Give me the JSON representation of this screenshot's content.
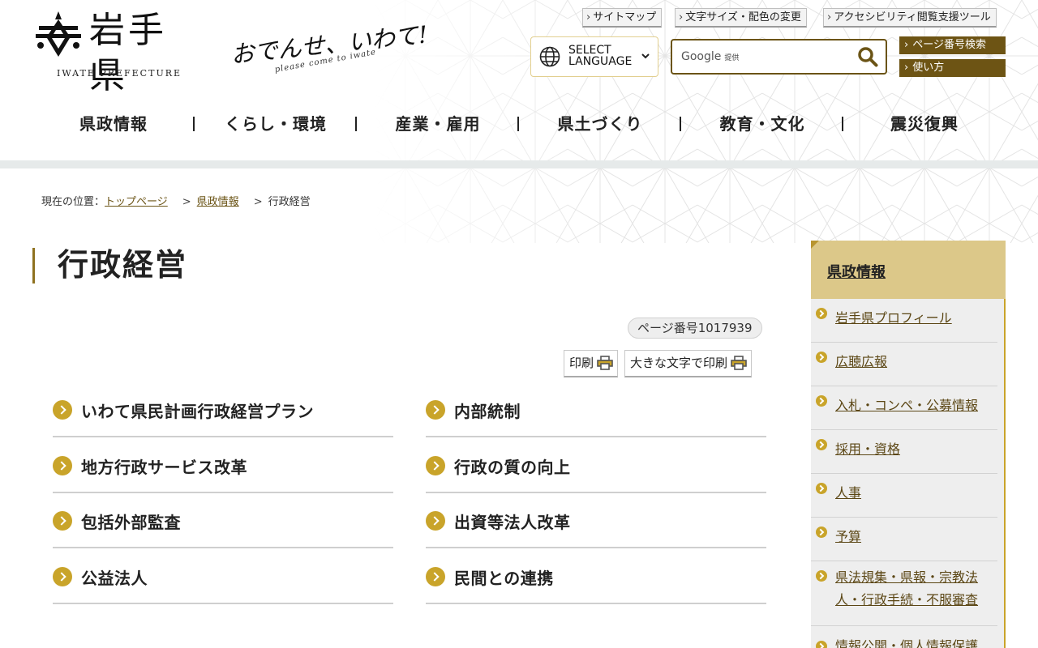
{
  "header": {
    "logo_name": "岩手県",
    "logo_sub": "IWATE PREFECTURE",
    "catch_main": "おでんせ、いわて!",
    "catch_sub": "please come to iwate",
    "util_links": [
      "サイトマップ",
      "文字サイズ・配色の変更",
      "アクセシビリティ閲覧支援ツール"
    ],
    "language": {
      "line1": "SELECT",
      "line2": "LANGUAGE"
    },
    "search": {
      "brand": "Google",
      "brand_sub": "提供",
      "placeholder": ""
    },
    "side_buttons": [
      "ページ番号検索",
      "使い方"
    ]
  },
  "global_nav": [
    "県政情報",
    "くらし・環境",
    "産業・雇用",
    "県土づくり",
    "教育・文化",
    "震災復興"
  ],
  "breadcrumb": {
    "prefix": "現在の位置：",
    "items": [
      "トップページ",
      "県政情報"
    ],
    "current": "行政経営"
  },
  "main": {
    "title": "行政経営",
    "page_number": "ページ番号1017939",
    "print_label": "印刷",
    "print_large_label": "大きな文字で印刷",
    "links": [
      "いわて県民計画行政経営プラン",
      "内部統制",
      "地方行政サービス改革",
      "行政の質の向上",
      "包括外部監査",
      "出資等法人改革",
      "公益法人",
      "民間との連携"
    ]
  },
  "sidenav": {
    "title": "県政情報",
    "items": [
      "岩手県プロフィール",
      "広聴広報",
      "入札・コンペ・公募情報",
      "採用・資格",
      "人事",
      "予算",
      "県法規集・県報・宗教法人・行政手続・不服審査",
      "情報公開・個人情報保護"
    ]
  },
  "colors": {
    "accent_gold": "#c9a42a",
    "brand_brown": "#6d5414",
    "side_header": "#dcc889"
  }
}
